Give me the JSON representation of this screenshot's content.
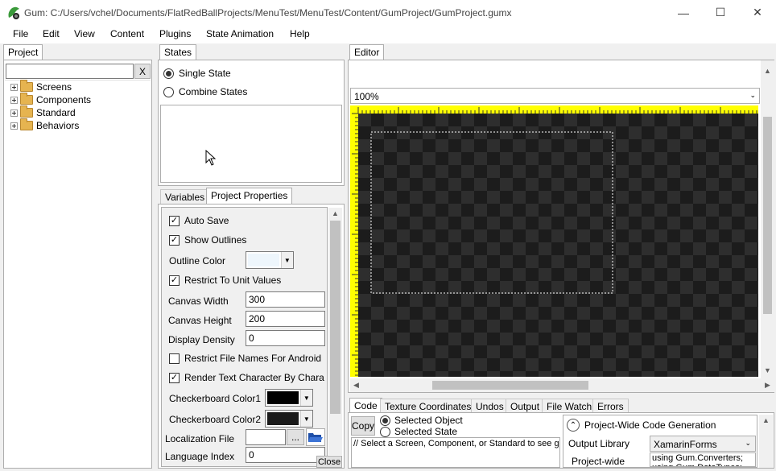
{
  "window": {
    "title": "Gum: C:/Users/vchel/Documents/FlatRedBallProjects/MenuTest/MenuTest/Content/GumProject/GumProject.gumx",
    "minimize": "—",
    "maximize": "☐",
    "close": "✕"
  },
  "menu": [
    "File",
    "Edit",
    "View",
    "Content",
    "Plugins",
    "State Animation",
    "Help"
  ],
  "project_panel": {
    "tab": "Project",
    "search_value": "",
    "clear_label": "X",
    "tree": [
      "Screens",
      "Components",
      "Standard",
      "Behaviors"
    ]
  },
  "states_panel": {
    "tab": "States",
    "single_state": "Single State",
    "combine_states": "Combine States",
    "selected": "single"
  },
  "props_panel": {
    "tabs": [
      "Variables",
      "Project Properties"
    ],
    "active_tab": "Project Properties",
    "auto_save": "Auto Save",
    "show_outlines": "Show Outlines",
    "outline_color": "Outline Color",
    "restrict_unit": "Restrict To Unit Values",
    "canvas_width_label": "Canvas Width",
    "canvas_width": "300",
    "canvas_height_label": "Canvas Height",
    "canvas_height": "200",
    "display_density_label": "Display Density",
    "display_density": "0",
    "restrict_android": "Restrict File Names For Android",
    "render_text": "Render Text Character By Chara",
    "checker1": "Checkerboard Color1",
    "checker2": "Checkerboard Color2",
    "localization": "Localization File",
    "browse": "...",
    "language_index_label": "Language Index",
    "language_index": "0",
    "close": "Close"
  },
  "editor": {
    "tab": "Editor",
    "zoom": "100%"
  },
  "bottom_panel": {
    "tabs": [
      "Code",
      "Texture Coordinates",
      "Undos",
      "Output",
      "File Watch",
      "Errors"
    ],
    "active_tab": "Code",
    "copy": "Copy",
    "selected_object": "Selected Object",
    "selected_state": "Selected State",
    "code_text": "// Select a Screen, Component, or Standard to see ge",
    "project_wide": "Project-Wide Code Generation",
    "output_library_label": "Output Library",
    "output_library": "XamarinForms",
    "project_wide_label": "Project-wide",
    "usings": "using Gum.Converters;\nusing Gum.DataTypes;"
  },
  "colors": {
    "ruler": "#ffff00",
    "canvas_dark": "#1c1c1c",
    "canvas_light": "#2e2e2e",
    "checker1": "#000000",
    "checker2": "#1a1a1a",
    "outline": "#eef6fc"
  }
}
